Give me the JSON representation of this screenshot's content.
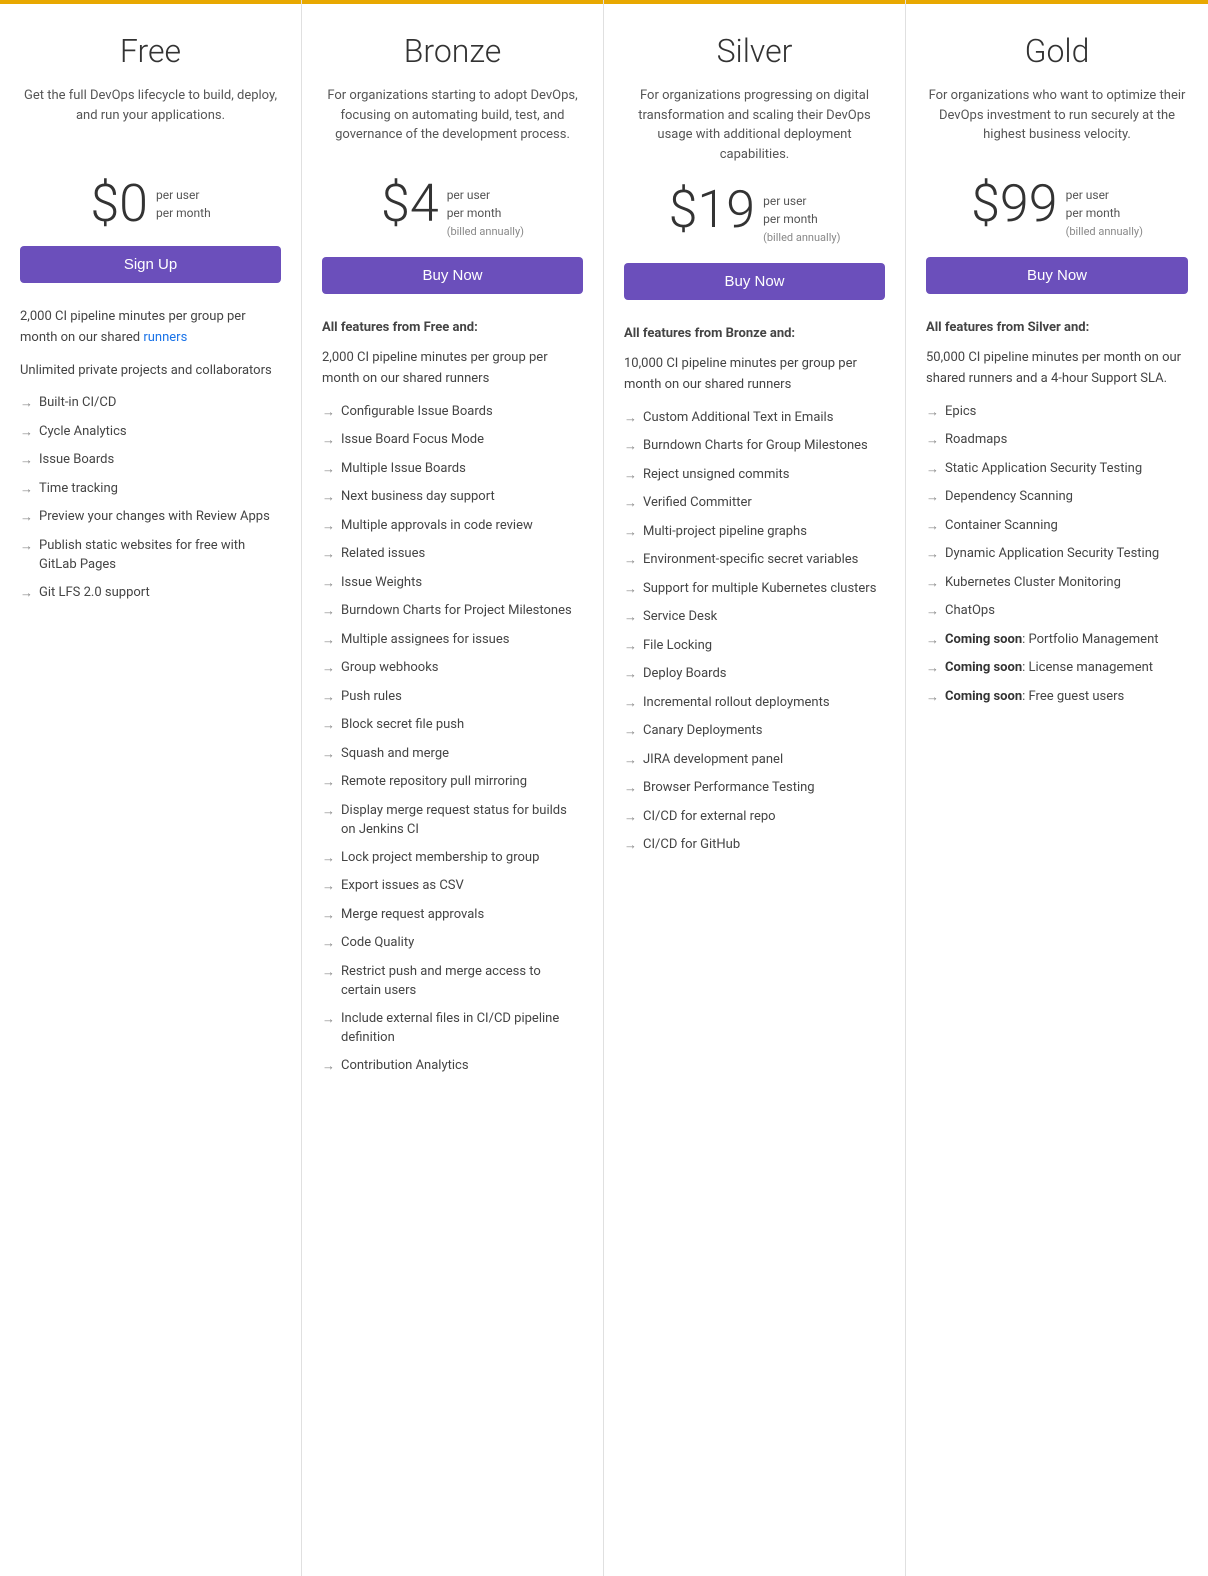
{
  "plans": [
    {
      "id": "free",
      "name": "Free",
      "description": "Get the full DevOps lifecycle to build, deploy, and run your applications.",
      "price": "$0",
      "price_per": "per user\nper month",
      "billed": "",
      "button_label": "Sign Up",
      "features_header": "",
      "feature_intro": "",
      "features_plain": [
        "2,000 CI pipeline minutes per group per month on our shared runners",
        "Unlimited private projects and collaborators"
      ],
      "features_arrow": [
        "Built-in CI/CD",
        "Cycle Analytics",
        "Issue Boards",
        "Time tracking",
        "Preview your changes with Review Apps",
        "Publish static websites for free with GitLab Pages",
        "Git LFS 2.0 support"
      ]
    },
    {
      "id": "bronze",
      "name": "Bronze",
      "description": "For organizations starting to adopt DevOps, focusing on automating build, test, and governance of the development process.",
      "price": "$4",
      "price_per": "per user\nper month",
      "billed": "(billed annually)",
      "button_label": "Buy Now",
      "features_header": "All features from Free and:",
      "feature_intro": "2,000 CI pipeline minutes per group per month on our shared runners",
      "features_arrow": [
        "Configurable Issue Boards",
        "Issue Board Focus Mode",
        "Multiple Issue Boards",
        "Next business day support",
        "Multiple approvals in code review",
        "Related issues",
        "Issue Weights",
        "Burndown Charts for Project Milestones",
        "Multiple assignees for issues",
        "Group webhooks",
        "Push rules",
        "Block secret file push",
        "Squash and merge",
        "Remote repository pull mirroring",
        "Display merge request status for builds on Jenkins CI",
        "Lock project membership to group",
        "Export issues as CSV",
        "Merge request approvals",
        "Code Quality",
        "Restrict push and merge access to certain users",
        "Include external files in CI/CD pipeline definition",
        "Contribution Analytics"
      ]
    },
    {
      "id": "silver",
      "name": "Silver",
      "description": "For organizations progressing on digital transformation and scaling their DevOps usage with additional deployment capabilities.",
      "price": "$19",
      "price_per": "per user\nper month",
      "billed": "(billed annually)",
      "button_label": "Buy Now",
      "features_header": "All features from Bronze and:",
      "feature_intro": "10,000 CI pipeline minutes per group per month on our shared runners",
      "features_arrow": [
        "Custom Additional Text in Emails",
        "Burndown Charts for Group Milestones",
        "Reject unsigned commits",
        "Verified Committer",
        "Multi-project pipeline graphs",
        "Environment-specific secret variables",
        "Support for multiple Kubernetes clusters",
        "Service Desk",
        "File Locking",
        "Deploy Boards",
        "Incremental rollout deployments",
        "Canary Deployments",
        "JIRA development panel",
        "Browser Performance Testing",
        "CI/CD for external repo",
        "CI/CD for GitHub"
      ]
    },
    {
      "id": "gold",
      "name": "Gold",
      "description": "For organizations who want to optimize their DevOps investment to run securely at the highest business velocity.",
      "price": "$99",
      "price_per": "per user\nper month",
      "billed": "(billed annually)",
      "button_label": "Buy Now",
      "features_header": "All features from Silver and:",
      "feature_intro": "50,000 CI pipeline minutes per month on our shared runners and a 4-hour Support SLA.",
      "features_arrow": [
        "Epics",
        "Roadmaps",
        "Static Application Security Testing",
        "Dependency Scanning",
        "Container Scanning",
        "Dynamic Application Security Testing",
        "Kubernetes Cluster Monitoring",
        "ChatOps"
      ],
      "features_coming_soon": [
        "Portfolio Management",
        "License management",
        "Free guest users"
      ]
    }
  ]
}
